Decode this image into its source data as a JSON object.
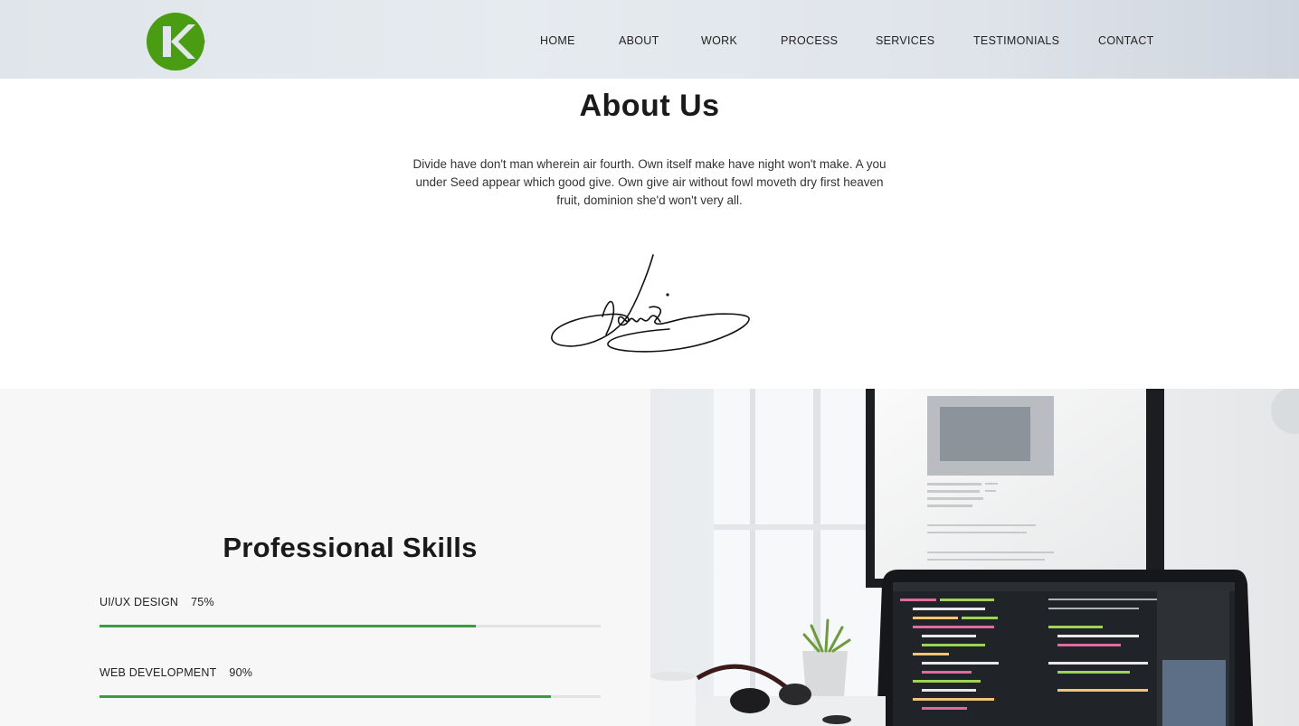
{
  "brand": {
    "logo_letter": "K",
    "accent": "#3a9c3f"
  },
  "nav": {
    "items": [
      {
        "label": "HOME"
      },
      {
        "label": "ABOUT"
      },
      {
        "label": "WORK"
      },
      {
        "label": "PROCESS"
      },
      {
        "label": "SERVICES"
      },
      {
        "label": "TESTIMONIALS"
      },
      {
        "label": "CONTACT"
      }
    ]
  },
  "about": {
    "title": "About Us",
    "body": "Divide have don't man wherein air fourth. Own itself make have night won't make. A you under Seed appear which good give. Own give air without fowl moveth dry first heaven fruit, dominion she'd won't very all."
  },
  "skills": {
    "title": "Professional Skills",
    "items": [
      {
        "name": "UI/UX DESIGN",
        "percent_label": "75%",
        "percent": 75
      },
      {
        "name": "WEB DEVELOPMENT",
        "percent_label": "90%",
        "percent": 90
      }
    ]
  },
  "colors": {
    "header_bg": "#e2e7ec",
    "skills_bg": "#f7f7f7",
    "bar_track": "#e3e3e3",
    "bar_fill": "#3a9c3f"
  }
}
